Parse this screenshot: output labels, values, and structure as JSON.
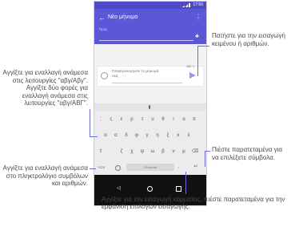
{
  "status_bar": {
    "time": "17:50"
  },
  "app_bar": {
    "back_icon": "arrow-left-icon",
    "title": "Νέο μήνυμα",
    "menu_icon": "more-vertical-icon",
    "to_label": "Προς",
    "add_contact_icon": "add-contact-icon"
  },
  "compose": {
    "counter": "160 / 1",
    "placeholder": "Πληκτρολογήστε το μήνυμά σας"
  },
  "keyboard": {
    "row1": [
      ";",
      "ς",
      "ε",
      "ρ",
      "τ",
      "υ",
      "θ",
      "ι",
      "ο",
      "π"
    ],
    "row2": [
      "α",
      "σ",
      "δ",
      "φ",
      "γ",
      "η",
      "ξ",
      "κ",
      "λ"
    ],
    "row3": [
      "ζ",
      "χ",
      "ψ",
      "ω",
      "β",
      "ν",
      "μ"
    ],
    "symbols_label": "?123",
    "space_label": "Ελληνικά",
    "comma_label": ","
  },
  "annotations": {
    "top_right": "Πατήστε για την εισαγωγή κειμένου ή αριθμών.",
    "mid_left": "Αγγίξτε για εναλλαγή ανάμεσα στις λειτουργίες \"αβγ/Αβγ\". Αγγίξτε δύο φορές για εναλλαγή ανάμεσα στις λειτουργίες \"αβγ/ΑΒΓ\".",
    "mid_right": "Πιέστε παρατεταμένα για να επιλέξετε σύμβολα.",
    "bottom_left": "Αγγίξτε για εναλλαγή ανάμεσα στο πληκτρολόγιο συμβόλων και αριθμών.",
    "bottom_center": "Αγγίξτε για την εισαγωγή κόμματος, πιέστε παρατεταμένα για την εμφάνιση επιλογών εισαγωγής."
  },
  "colors": {
    "accent": "#5b57d6",
    "annotation_line": "#6a6ad8"
  }
}
